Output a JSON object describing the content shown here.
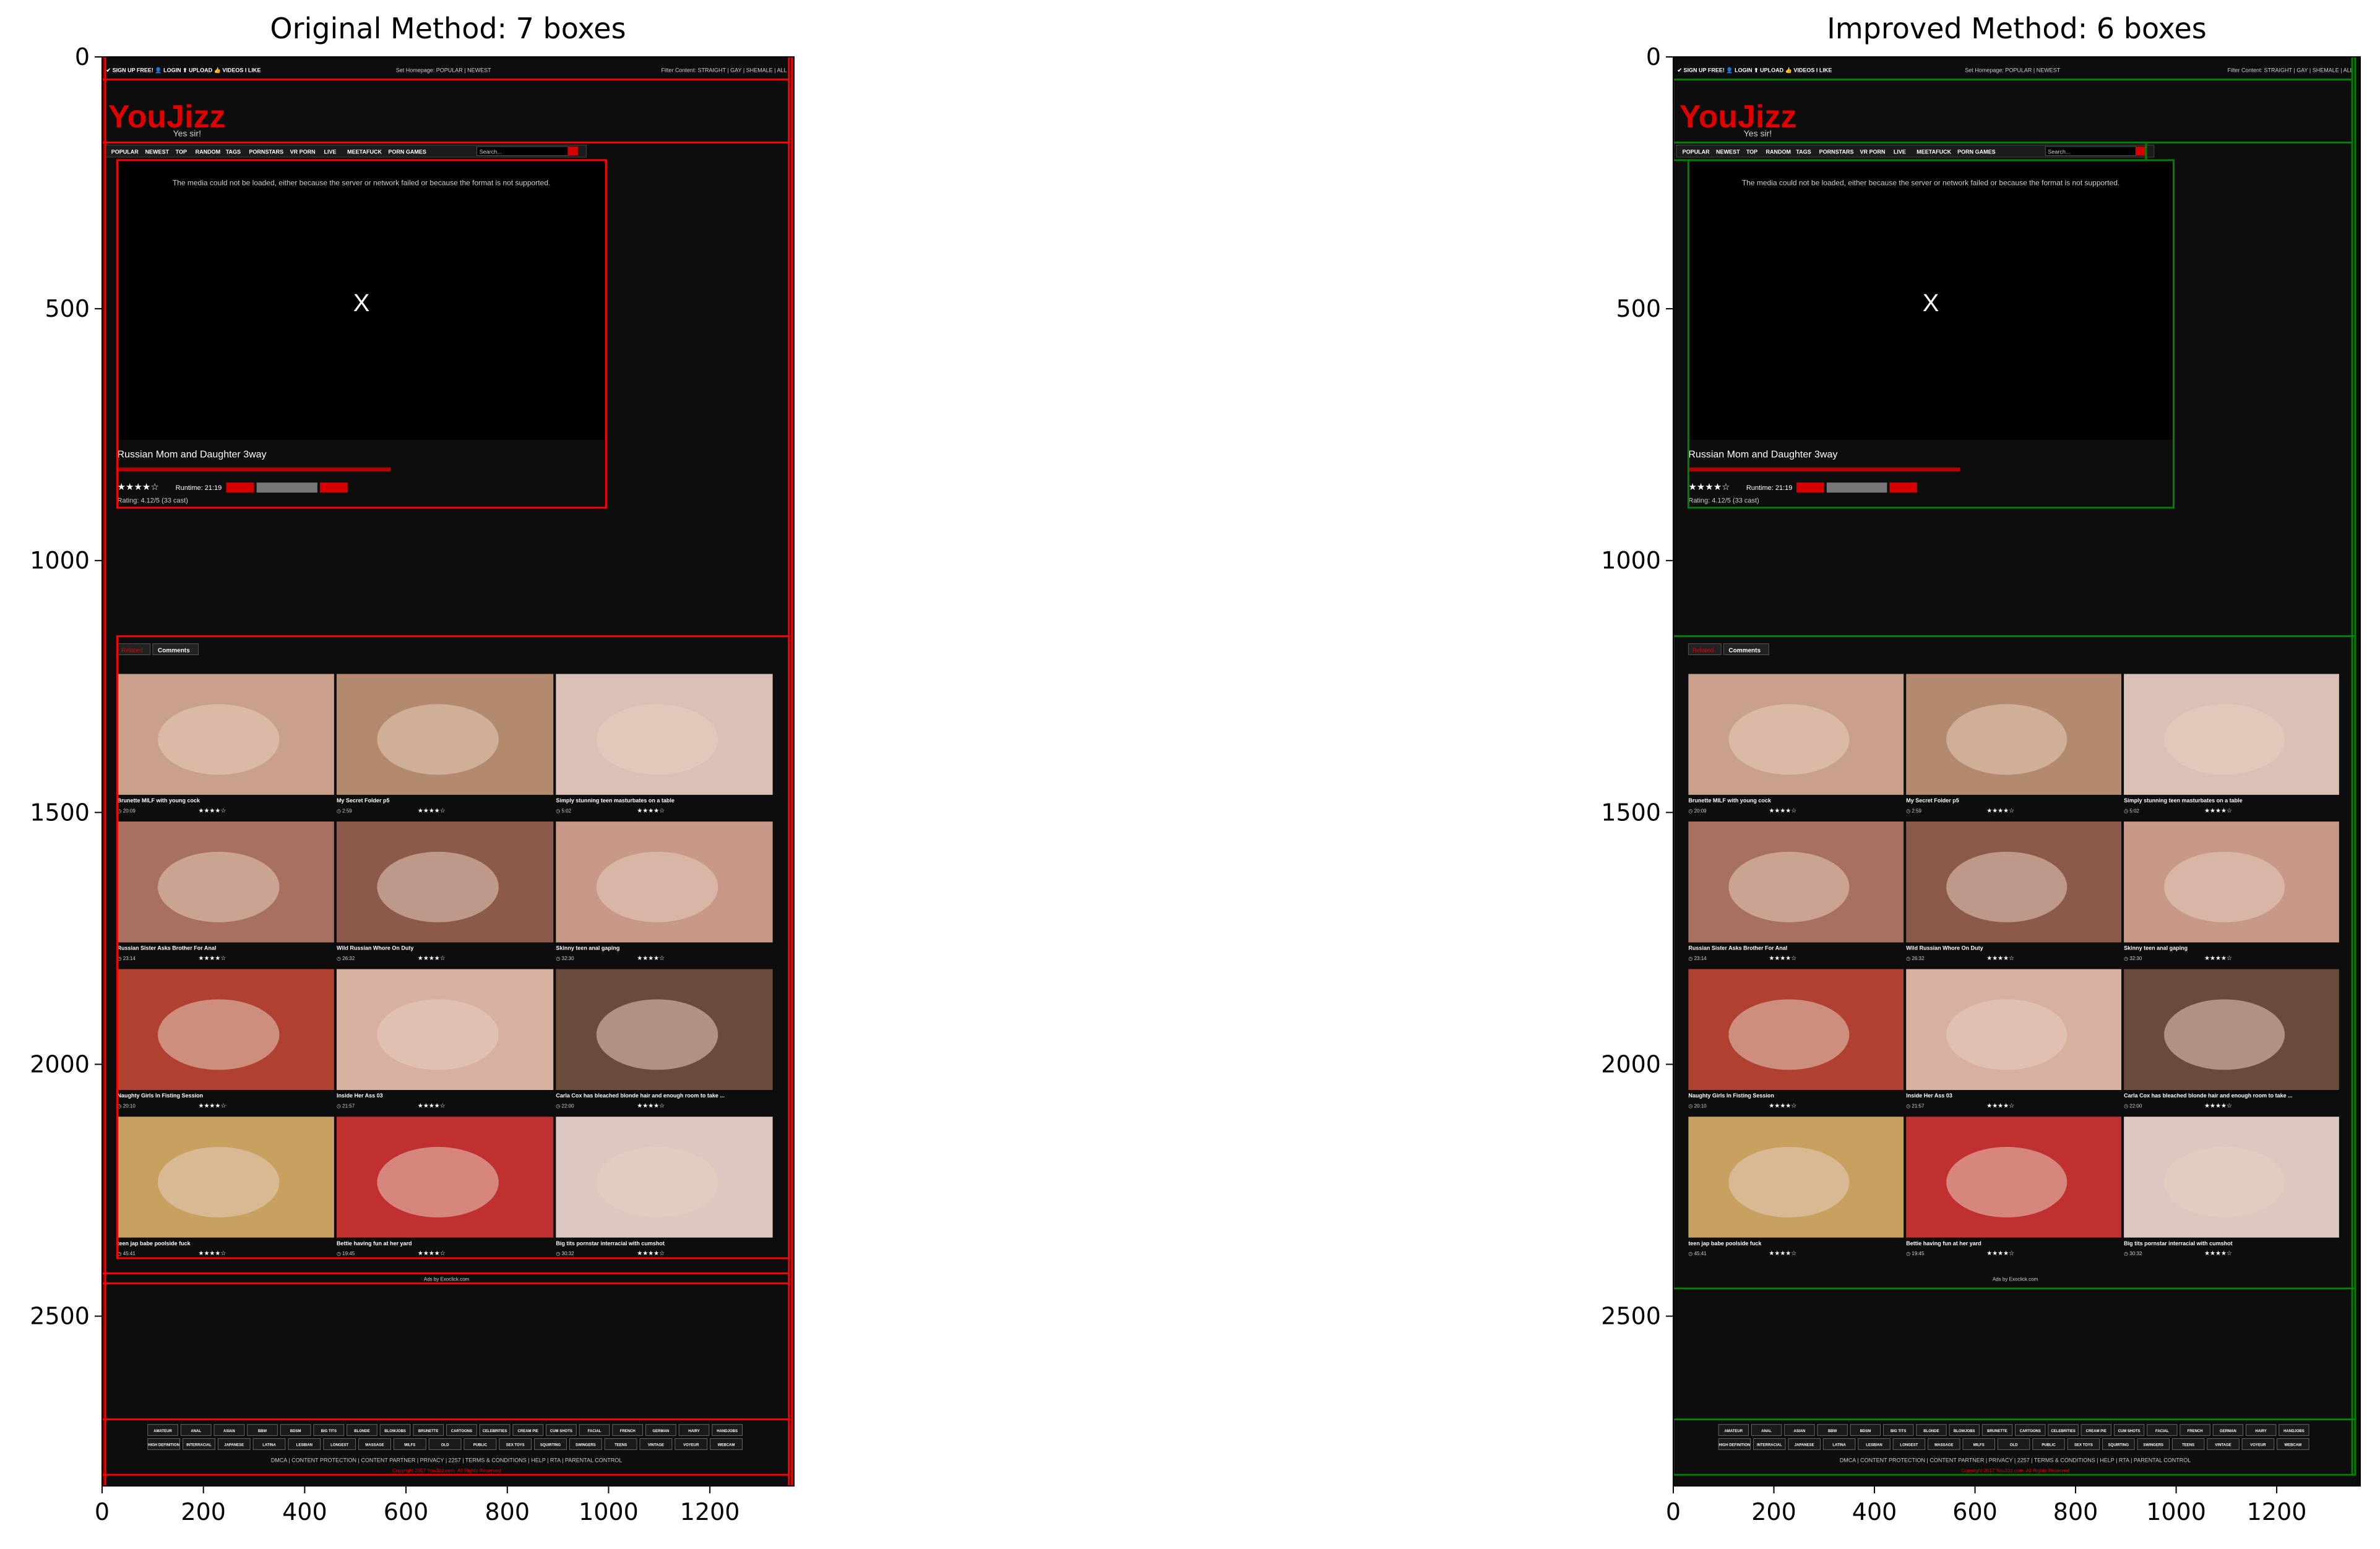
{
  "chart_data": [
    {
      "type": "image-with-boxes",
      "title": "Original Method: 7 boxes",
      "box_color": "#ff0000",
      "xlim": [
        0,
        1366
      ],
      "ylim": [
        2837,
        0
      ],
      "x_ticks": [
        0,
        200,
        400,
        600,
        800,
        1000,
        1200
      ],
      "y_ticks": [
        0,
        500,
        1000,
        1500,
        2000,
        2500
      ],
      "boxes": [
        {
          "label": "header-logo",
          "x0": 0,
          "y0": 45,
          "x1": 1356,
          "y1": 170
        },
        {
          "label": "video-player",
          "x0": 30,
          "y0": 205,
          "x1": 995,
          "y1": 895
        },
        {
          "label": "related-videos",
          "x0": 30,
          "y0": 1150,
          "x1": 1356,
          "y1": 2385
        },
        {
          "label": "ads-bar",
          "x0": 0,
          "y0": 2415,
          "x1": 1356,
          "y1": 2435
        },
        {
          "label": "footer",
          "x0": 0,
          "y0": 2705,
          "x1": 1356,
          "y1": 2815
        },
        {
          "label": "page-left",
          "x0": 0,
          "y0": 0,
          "x1": 6,
          "y1": 2837
        },
        {
          "label": "page-right",
          "x0": 1356,
          "y0": 0,
          "x1": 1362,
          "y1": 2837
        }
      ]
    },
    {
      "type": "image-with-boxes",
      "title": "Improved Method: 6 boxes",
      "box_color": "#008000",
      "xlim": [
        0,
        1366
      ],
      "ylim": [
        2837,
        0
      ],
      "x_ticks": [
        0,
        200,
        400,
        600,
        800,
        1000,
        1200
      ],
      "y_ticks": [
        0,
        500,
        1000,
        1500,
        2000,
        2500
      ],
      "boxes": [
        {
          "label": "header-logo",
          "x0": 0,
          "y0": 45,
          "x1": 1350,
          "y1": 170
        },
        {
          "label": "nav-bar",
          "x0": 0,
          "y0": 170,
          "x1": 940,
          "y1": 205
        },
        {
          "label": "video-player",
          "x0": 30,
          "y0": 205,
          "x1": 995,
          "y1": 895
        },
        {
          "label": "related-videos",
          "x0": 0,
          "y0": 1150,
          "x1": 1356,
          "y1": 2445
        },
        {
          "label": "footer",
          "x0": 0,
          "y0": 2705,
          "x1": 1356,
          "y1": 2815
        },
        {
          "label": "page-right",
          "x0": 1350,
          "y0": 0,
          "x1": 1356,
          "y1": 2815
        }
      ]
    }
  ],
  "screenshot": {
    "top_bar_left": "✔ SIGN UP FREE! 👤 LOGIN ⬆ UPLOAD 👍 VIDEOS I LIKE",
    "top_bar_mid": "Set Homepage: POPULAR | NEWEST",
    "top_bar_right": "Filter Content: STRAIGHT | GAY | SHEMALE | ALL",
    "logo_main": "YouJizz",
    "logo_tag": "Yes sir!",
    "nav": [
      "POPULAR",
      "NEWEST",
      "TOP",
      "RANDOM",
      "TAGS",
      "PORNSTARS",
      "VR PORN",
      "LIVE",
      "MEETAFUCK",
      "PORN GAMES"
    ],
    "search_placeholder": "Search...",
    "player_error": "The media could not be loaded, either because the server or network failed or because the format is not supported.",
    "player_x": "X",
    "video_title": "Russian Mom and Daughter 3way",
    "runtime": "Runtime: 21:19",
    "rating": "Rating: 4.12/5 (33 cast)",
    "btn_embed": "Embed",
    "btn_fav": "Add To Favorites",
    "btn_like": "Like",
    "tabs": [
      "Related",
      "Comments"
    ],
    "thumbs": [
      {
        "title": "Brunette MILF with young cock",
        "dur": "20:09"
      },
      {
        "title": "My Secret Folder p5",
        "dur": "2:59"
      },
      {
        "title": "Simply stunning teen masturbates on a table",
        "dur": "5:02"
      },
      {
        "title": "Russian Sister Asks Brother For Anal",
        "dur": "23:14"
      },
      {
        "title": "Wild Russian Whore On Duty",
        "dur": "26:32"
      },
      {
        "title": "Skinny teen anal gaping",
        "dur": "32:30"
      },
      {
        "title": "Naughty Girls In Fisting Session",
        "dur": "20:10"
      },
      {
        "title": "Inside Her Ass 03",
        "dur": "21:57"
      },
      {
        "title": "Carla Cox has bleached blonde hair and enough room to take ...",
        "dur": "22:00"
      },
      {
        "title": "teen jap babe poolside fuck",
        "dur": "45:41"
      },
      {
        "title": "Bettie having fun at her yard",
        "dur": "19:45"
      },
      {
        "title": "Big tits pornstar interracial with cumshot",
        "dur": "30:32"
      }
    ],
    "ads_line": "Ads by Exoclick.com",
    "footer_links": "DMCA | CONTENT PROTECTION | CONTENT PARTNER | PRIVACY | 2257 | TERMS & CONDITIONS | HELP | RTA | PARENTAL CONTROL",
    "footer_copyright": "Copyright 2017 YouJizz.com. All Rights Reserved",
    "footer_tags": [
      "AMATEUR",
      "ANAL",
      "ASIAN",
      "BBW",
      "BDSM",
      "BIG TITS",
      "BLONDE",
      "BLOWJOBS",
      "BRUNETTE",
      "CARTOONS",
      "CELEBRITIES",
      "CREAM PIE",
      "CUM SHOTS",
      "FACIAL",
      "FRENCH",
      "GERMAN",
      "HAIRY",
      "HANDJOBS",
      "HIGH DEFINITION",
      "INTERRACIAL",
      "JAPANESE",
      "LATINA",
      "LESBIAN",
      "LONGEST",
      "MASSAGE",
      "MILFS",
      "OLD",
      "PUBLIC",
      "SEX TOYS",
      "SQUIRTING",
      "SWINGERS",
      "TEENS",
      "VINTAGE",
      "VOYEUR",
      "WEBCAM"
    ]
  }
}
